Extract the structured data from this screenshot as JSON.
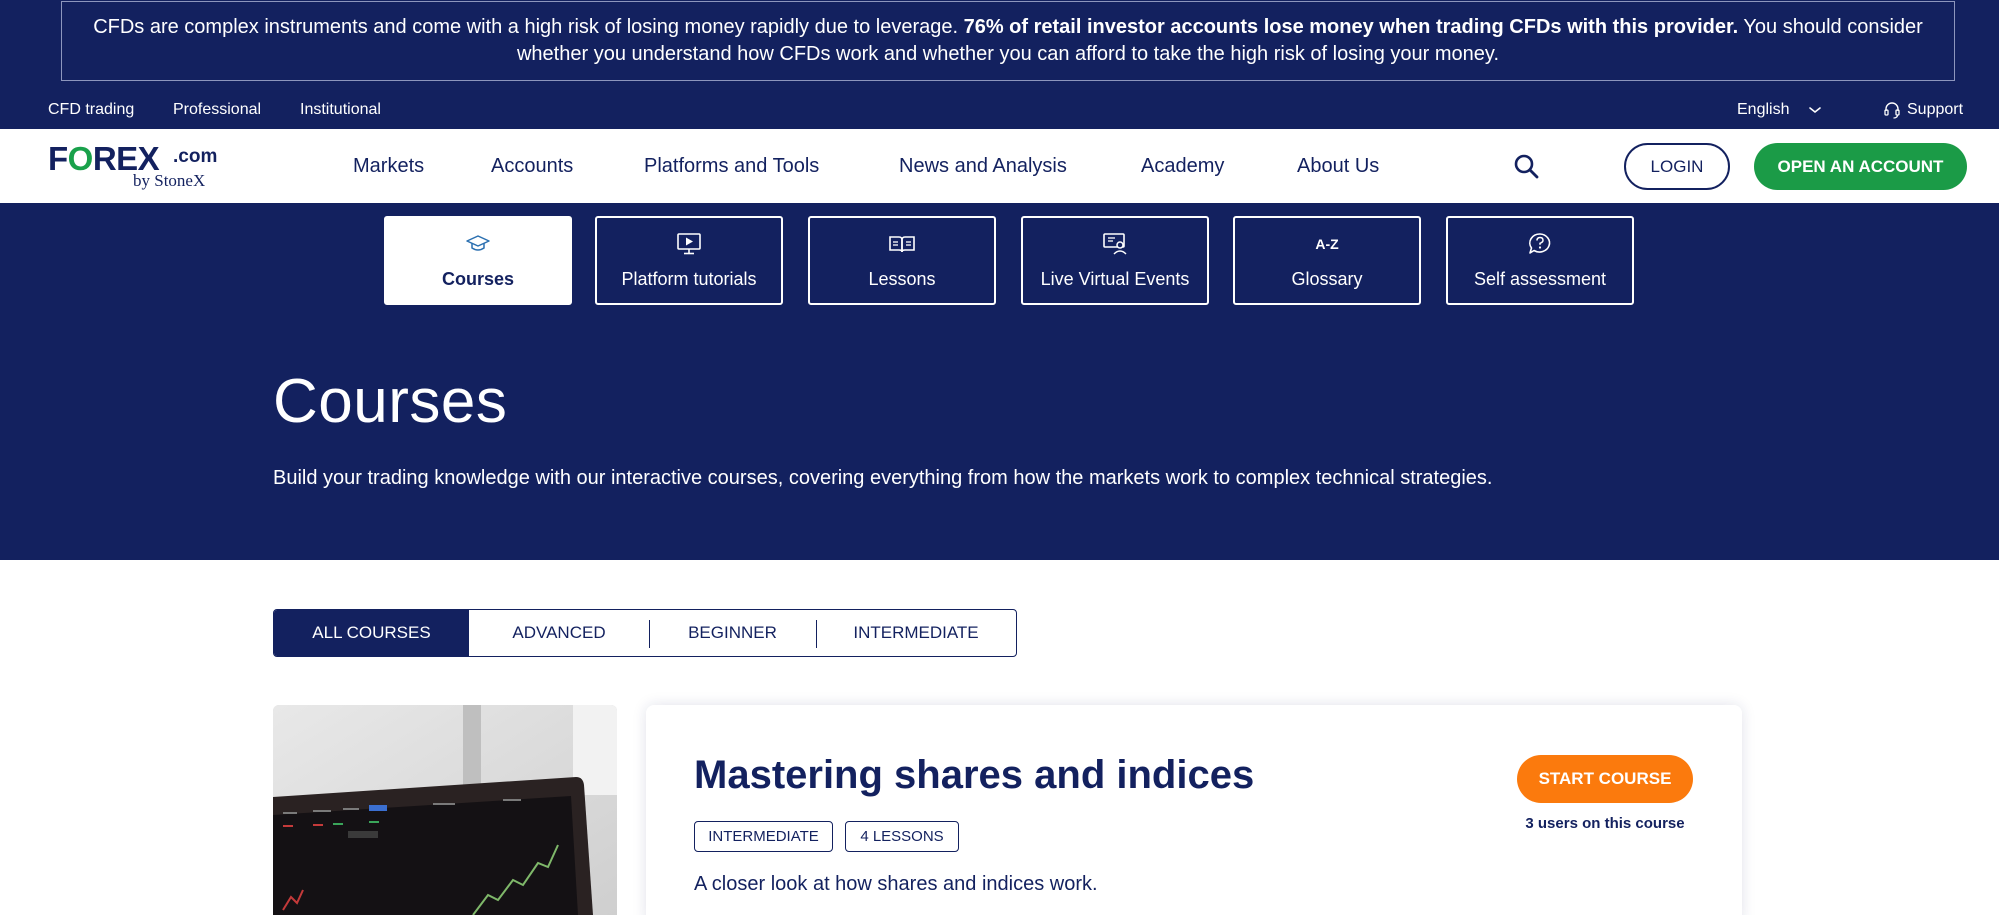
{
  "risk_warning": {
    "text_before": "CFDs are complex instruments and come with a high risk of losing money rapidly due to leverage. ",
    "bold_text": "76% of retail investor accounts lose money when trading CFDs with this provider.",
    "text_after": " You should consider whether you understand how CFDs work and whether you can afford to take the high risk of losing your money."
  },
  "utility_nav": {
    "links": [
      "CFD trading",
      "Professional",
      "Institutional"
    ],
    "language": "English",
    "support": "Support"
  },
  "logo": {
    "main_prefix": "F",
    "main_o": "O",
    "main_suffix": "REX",
    "domain": ".com",
    "byline": "by StoneX"
  },
  "main_nav": {
    "items": [
      "Markets",
      "Accounts",
      "Platforms and Tools",
      "News and Analysis",
      "Academy",
      "About Us"
    ],
    "login": "LOGIN",
    "open_account": "OPEN AN ACCOUNT"
  },
  "academy_tiles": [
    {
      "label": "Courses",
      "icon": "graduation-cap-icon",
      "active": true
    },
    {
      "label": "Platform tutorials",
      "icon": "video-play-icon",
      "active": false
    },
    {
      "label": "Lessons",
      "icon": "open-book-icon",
      "active": false
    },
    {
      "label": "Live Virtual Events",
      "icon": "presenter-screen-icon",
      "active": false
    },
    {
      "label": "Glossary",
      "icon": "a-z-icon",
      "glyph": "A-Z",
      "active": false
    },
    {
      "label": "Self assessment",
      "icon": "question-bubble-icon",
      "active": false
    }
  ],
  "hero": {
    "title": "Courses",
    "description": "Build your trading knowledge with our interactive courses, covering everything from how the markets work to complex technical strategies."
  },
  "filters": {
    "tabs": [
      "ALL COURSES",
      "ADVANCED",
      "BEGINNER",
      "INTERMEDIATE"
    ],
    "active": "ALL COURSES"
  },
  "course": {
    "title": "Mastering shares and indices",
    "tags": [
      "INTERMEDIATE",
      "4 LESSONS"
    ],
    "description": "A closer look at how shares and indices work.",
    "start_label": "START COURSE",
    "users": "3 users on this course"
  },
  "colors": {
    "navy": "#13215f",
    "green": "#1b9b47",
    "orange": "#fb7a0d",
    "white": "#ffffff"
  }
}
